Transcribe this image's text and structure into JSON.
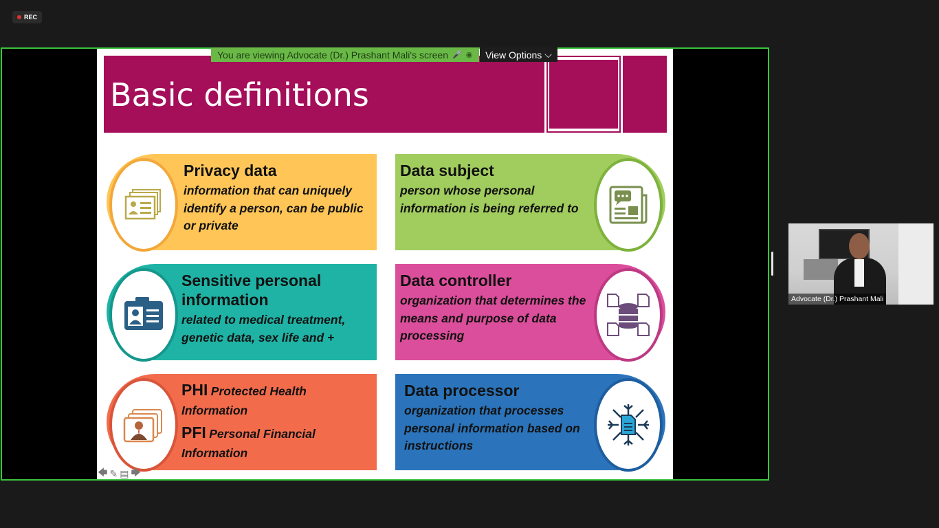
{
  "recording": {
    "label": "REC"
  },
  "banner": {
    "text": "You are viewing Advocate (Dr.) Prashant Mali's screen"
  },
  "view_options": {
    "label": "View Options",
    "chevron": "⌵"
  },
  "slide": {
    "title": "Basic definitions",
    "cards": [
      {
        "title": "Privacy data",
        "body": "information that can uniquely identify a person, can be public or private",
        "icon": "id-cards-icon",
        "color": "#ffc657"
      },
      {
        "title": "Data subject",
        "body": "person whose personal information is being referred to",
        "icon": "newspaper-chat-icon",
        "color": "#a1cc5e"
      },
      {
        "title": "Sensitive personal information",
        "body": "related to medical treatment, genetic data, sex life and +",
        "icon": "id-badge-icon",
        "color": "#1fb3a5"
      },
      {
        "title": "Data controller",
        "body": "organization that determines the means and purpose of data processing",
        "icon": "database-documents-icon",
        "color": "#db4e9b"
      },
      {
        "term1": "PHI",
        "full1": "Protected Health Information",
        "term2": "PFI",
        "full2": "Personal Financial Information",
        "icon": "user-cards-icon",
        "color": "#f26c4c"
      },
      {
        "title": "Data processor",
        "body": "organization that processes personal information based on instructions",
        "icon": "document-network-icon",
        "color": "#2b74bb"
      }
    ]
  },
  "participant": {
    "name": "Advocate (Dr.) Prashant Mali"
  }
}
